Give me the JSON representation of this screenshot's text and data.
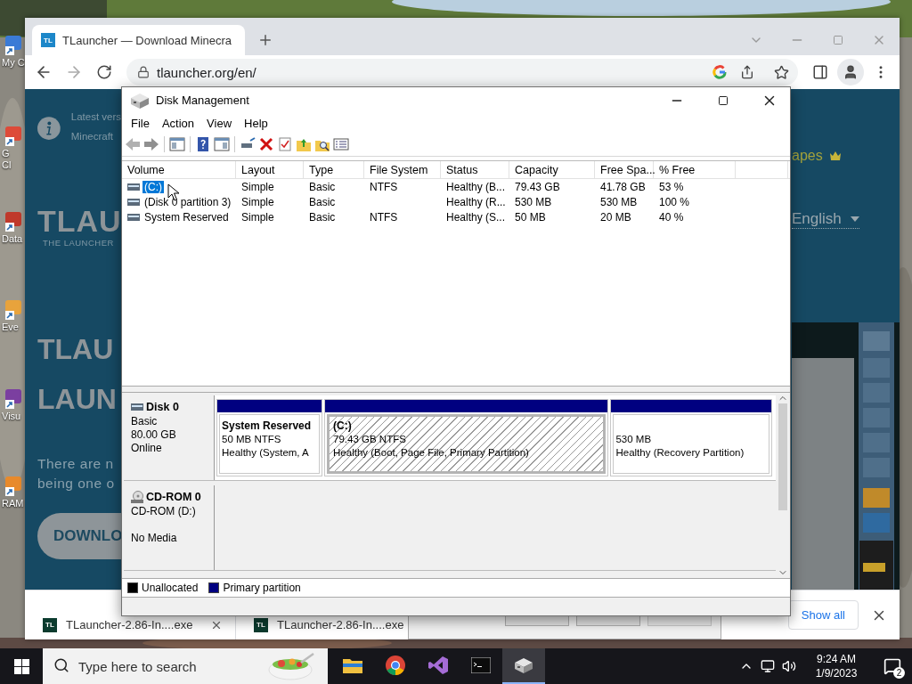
{
  "desktop": {
    "icons": [
      {
        "label": [
          "My C"
        ]
      },
      {
        "label": [
          "G",
          "Cl"
        ]
      },
      {
        "label": [
          "Data"
        ]
      },
      {
        "label": [
          "Eve"
        ]
      },
      {
        "label": [
          "Visu"
        ]
      },
      {
        "label": [
          "RAM"
        ]
      }
    ]
  },
  "browser": {
    "tabs": [
      {
        "favicon": "TL",
        "title": "TLauncher — Download Minecra",
        "selected": true
      }
    ],
    "address": "tlauncher.org/en/",
    "page": {
      "notice": [
        "Latest vers",
        "Minecraft"
      ],
      "logo": "TLAU",
      "tagline": "THE LAUNCHER",
      "nav_link": "apes",
      "language": "English",
      "headline": [
        "TLAU",
        "LAUN"
      ],
      "intro": [
        "There are n",
        "being one o"
      ],
      "download_button": "DOWNLO"
    },
    "downloads": [
      {
        "icon": "TL",
        "name": "TLauncher-2.86-In....exe",
        "hovered": true
      },
      {
        "icon": "TL",
        "name": "TLauncher-2.86-In....exe"
      }
    ],
    "show_all": "Show all"
  },
  "disk_management": {
    "title": "Disk Management",
    "menu": [
      "File",
      "Action",
      "View",
      "Help"
    ],
    "columns": [
      "Volume",
      "Layout",
      "Type",
      "File System",
      "Status",
      "Capacity",
      "Free Spa...",
      "% Free"
    ],
    "rows": [
      {
        "selected": true,
        "volume": "(C:)",
        "layout": "Simple",
        "type": "Basic",
        "file_system": "NTFS",
        "status": "Healthy (B...",
        "capacity": "79.43 GB",
        "free_space": "41.78 GB",
        "percent_free": "53 %"
      },
      {
        "selected": false,
        "volume": "(Disk 0 partition 3)",
        "layout": "Simple",
        "type": "Basic",
        "status": "Healthy (R...",
        "capacity": "530 MB",
        "free_space": "530 MB",
        "percent_free": "100 %"
      },
      {
        "selected": false,
        "volume": "System Reserved",
        "layout": "Simple",
        "type": "Basic",
        "file_system": "NTFS",
        "status": "Healthy (S...",
        "capacity": "50 MB",
        "free_space": "20 MB",
        "percent_free": "40 %"
      }
    ],
    "disks": [
      {
        "kind": "disk",
        "name": "Disk 0",
        "details": [
          "Basic",
          "80.00 GB",
          "Online"
        ],
        "partitions": [
          {
            "label": "System Reserved",
            "details": [
              "50 MB NTFS",
              "Healthy (System, A"
            ],
            "selected": false
          },
          {
            "label": "(C:)",
            "details": [
              "79.43 GB NTFS",
              "Healthy (Boot, Page File, Primary Partition)"
            ],
            "selected": true
          },
          {
            "details": [
              "530 MB",
              "Healthy (Recovery Partition)"
            ],
            "selected": false
          }
        ]
      },
      {
        "kind": "cdrom",
        "name": "CD-ROM 0",
        "details": [
          "CD-ROM (D:)"
        ],
        "media": "No Media"
      }
    ],
    "legend": [
      {
        "label": "Unallocated",
        "color": "#000000"
      },
      {
        "label": "Primary partition",
        "color": "#000080"
      }
    ]
  },
  "taskbar": {
    "search_placeholder": "Type here to search",
    "apps": [
      {
        "kind": "explorer",
        "selected": false
      },
      {
        "kind": "chrome",
        "selected": false
      },
      {
        "kind": "studio",
        "selected": false
      },
      {
        "kind": "terminal",
        "selected": false
      },
      {
        "kind": "disk",
        "selected": true
      }
    ],
    "time": "9:24 AM",
    "date": "1/9/2023",
    "notification_count": "2"
  }
}
